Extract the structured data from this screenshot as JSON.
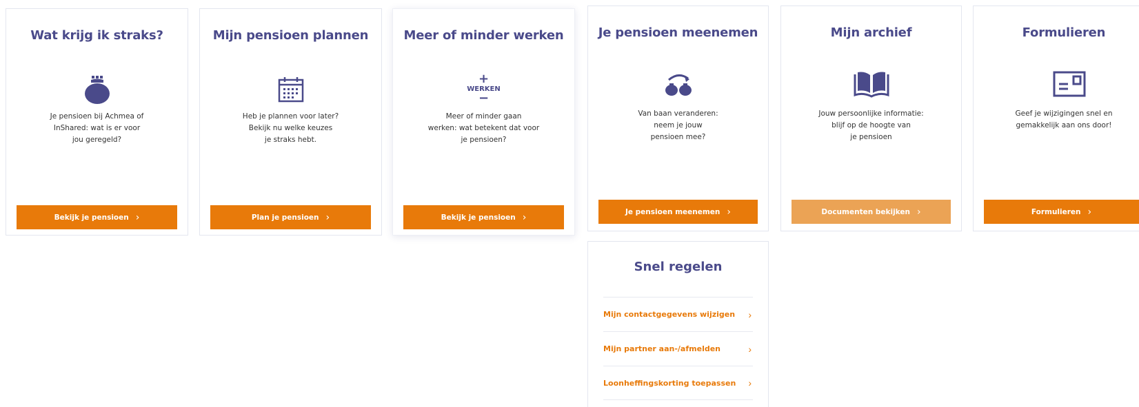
{
  "colors": {
    "title": "#4a4a8a",
    "accent": "#e87a0a",
    "accent_faded": "#eba355",
    "icon": "#4a4a8a"
  },
  "cards": [
    {
      "title": "Wat krijg ik straks?",
      "icon": "piggy-purse-icon",
      "description": "Je pensioen bij Achmea of\nInShared: wat is er voor\njou geregeld?",
      "button": "Bekijk je pensioen"
    },
    {
      "title": "Mijn pensioen plannen",
      "icon": "calendar-icon",
      "description": "Heb je plannen voor later?\nBekijk nu welke keuzes\nje straks hebt.",
      "button": "Plan je pensioen"
    },
    {
      "title": "Meer of minder werken",
      "icon": "plus-minus-werken-icon",
      "icon_text": "WERKEN",
      "description": "Meer of minder gaan\nwerken: wat betekent dat voor\nje pensioen?",
      "button": "Bekijk je pensioen"
    },
    {
      "title": "Je pensioen meenemen",
      "icon": "transfer-icon",
      "description": "Van baan veranderen:\nneem je jouw\npensioen mee?",
      "button": "Je pensioen meenemen"
    },
    {
      "title": "Mijn archief",
      "icon": "open-book-icon",
      "description": "Jouw persoonlijke informatie:\nblijf op de hoogte van\nje pensioen",
      "button": "Documenten bekijken"
    },
    {
      "title": "Formulieren",
      "icon": "envelope-form-icon",
      "description": "Geef je wijzigingen snel en\ngemakkelijk aan ons door!",
      "button": "Formulieren"
    }
  ],
  "snel_regelen": {
    "title": "Snel regelen",
    "items": [
      "Mijn contactgegevens wijzigen",
      "Mijn partner aan-/afmelden",
      "Loonheffingskorting toepassen"
    ]
  }
}
